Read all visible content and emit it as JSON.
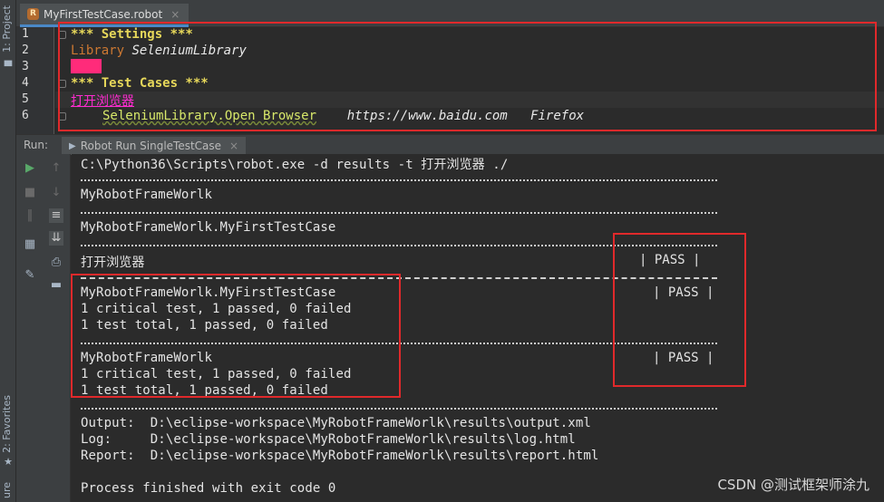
{
  "sidebar": {
    "project_label": "1: Project",
    "favorites_label": "2: Favorites",
    "structure_label": "ure"
  },
  "editor": {
    "tab_label": "MyFirstTestCase.robot",
    "lines": [
      "1",
      "2",
      "3",
      "4",
      "5",
      "6"
    ],
    "settings_header": "*** Settings ***",
    "library_keyword": "Library",
    "library_name": "SeleniumLibrary",
    "test_cases_header": "*** Test Cases ***",
    "test_name": "打开浏览器",
    "keyword_call": "SeleniumLibrary.Open Browser",
    "arg_url": "https://www.baidu.com",
    "arg_browser": "Firefox"
  },
  "run": {
    "label": "Run:",
    "tab_label": "Robot Run SingleTestCase"
  },
  "console": {
    "command": "C:\\Python36\\Scripts\\robot.exe -d results -t 打开浏览器 ./",
    "suite_name": "MyRobotFrameWorlk",
    "sub_suite": "MyRobotFrameWorlk.MyFirstTestCase",
    "test_row": "打开浏览器",
    "test_status": "| PASS |",
    "sub_suite_row": "MyRobotFrameWorlk.MyFirstTestCase",
    "sub_suite_status": "| PASS |",
    "sub_crit": "1 critical test, 1 passed, 0 failed",
    "sub_total": "1 test total, 1 passed, 0 failed",
    "suite_row": "MyRobotFrameWorlk",
    "suite_status": "| PASS |",
    "suite_crit": "1 critical test, 1 passed, 0 failed",
    "suite_total": "1 test total, 1 passed, 0 failed",
    "output_line": "Output:  D:\\eclipse-workspace\\MyRobotFrameWorlk\\results\\output.xml",
    "log_line": "Log:     D:\\eclipse-workspace\\MyRobotFrameWorlk\\results\\log.html",
    "report_line": "Report:  D:\\eclipse-workspace\\MyRobotFrameWorlk\\results\\report.html",
    "exit_line": "Process finished with exit code 0"
  },
  "watermark": "CSDN @测试框架师涂九",
  "colors": {
    "annotation_red": "#e0292b",
    "run_green": "#59a869"
  }
}
